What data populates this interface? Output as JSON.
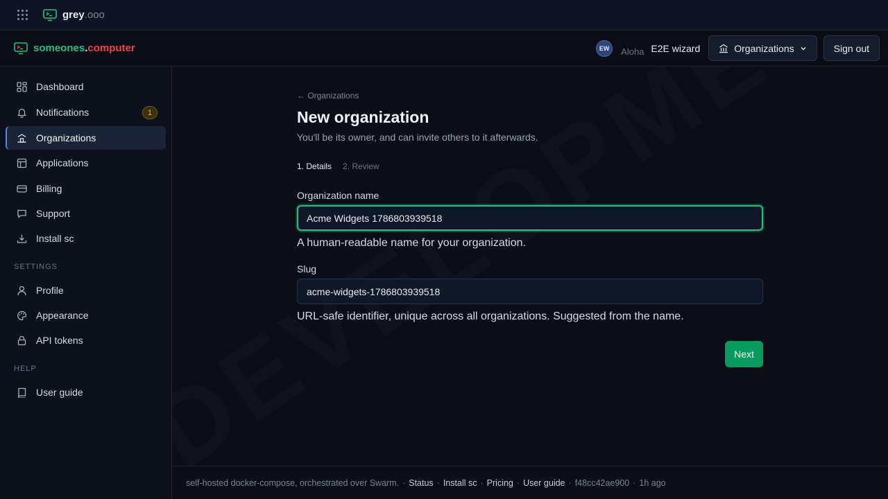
{
  "topbar": {
    "brand_name": "grey",
    "brand_tld": ".ooo"
  },
  "header": {
    "brand_name": "someones",
    "brand_dot": ".",
    "brand_tld": "computer",
    "avatar_initials": "EW",
    "greeting": "Aloha",
    "username": "E2E wizard",
    "org_button": "Organizations",
    "signout": "Sign out"
  },
  "sidebar": {
    "items": [
      {
        "label": "Dashboard",
        "icon": "dashboard-icon"
      },
      {
        "label": "Notifications",
        "icon": "bell-icon",
        "badge": "1"
      },
      {
        "label": "Organizations",
        "icon": "building-icon",
        "active": true
      },
      {
        "label": "Applications",
        "icon": "layout-icon"
      },
      {
        "label": "Billing",
        "icon": "credit-card-icon"
      },
      {
        "label": "Support",
        "icon": "chat-icon"
      },
      {
        "label": "Install sc",
        "icon": "download-icon"
      }
    ],
    "settings_label": "SETTINGS",
    "settings_items": [
      {
        "label": "Profile",
        "icon": "user-icon"
      },
      {
        "label": "Appearance",
        "icon": "palette-icon"
      },
      {
        "label": "API tokens",
        "icon": "lock-icon"
      }
    ],
    "help_label": "HELP",
    "help_items": [
      {
        "label": "User guide",
        "icon": "book-icon"
      }
    ]
  },
  "main": {
    "watermark": "DEVELOPMENT",
    "back_link": "← Organizations",
    "title": "New organization",
    "subtitle": "You'll be its owner, and can invite others to it afterwards.",
    "steps": [
      "1. Details",
      "2. Review"
    ],
    "org_name_label": "Organization name",
    "org_name_value": "Acme Widgets 1786803939518",
    "org_name_help": "A human-readable name for your organization.",
    "slug_label": "Slug",
    "slug_value": "acme-widgets-1786803939518",
    "slug_help": "URL-safe identifier, unique across all organizations. Suggested from the name.",
    "next_button": "Next"
  },
  "footer": {
    "text": "self-hosted docker-compose, orchestrated over Swarm.",
    "links": [
      "Status",
      "Install sc",
      "Pricing",
      "User guide"
    ],
    "commit": "f48cc42ae900",
    "age": "1h ago"
  },
  "colors": {
    "accent": "#22c27e",
    "brand_tld": "#ef4444",
    "primary_button": "#069a5e"
  }
}
